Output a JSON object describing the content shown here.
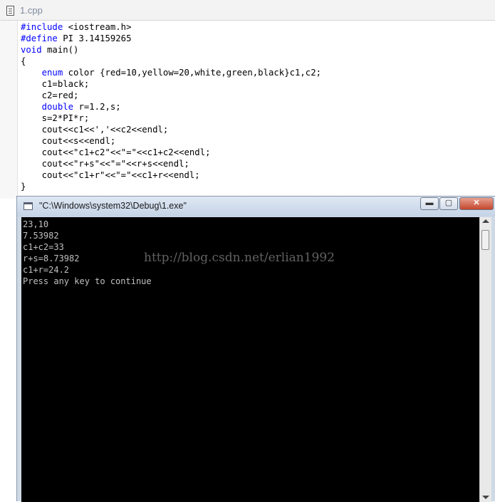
{
  "editor": {
    "tab_title": "1.cpp",
    "code_lines": [
      [
        {
          "t": "#include",
          "c": "pp"
        },
        {
          "t": " <iostream.h>"
        }
      ],
      [
        {
          "t": "#define",
          "c": "pp"
        },
        {
          "t": " PI 3.14159265"
        }
      ],
      [
        {
          "t": "void",
          "c": "kw"
        },
        {
          "t": " main()"
        }
      ],
      [
        {
          "t": "{"
        }
      ],
      [
        {
          "t": "    "
        },
        {
          "t": "enum",
          "c": "kw"
        },
        {
          "t": " color {red=10,yellow=20,white,green,black}c1,c2;"
        }
      ],
      [
        {
          "t": "    c1=black;"
        }
      ],
      [
        {
          "t": "    c2=red;"
        }
      ],
      [
        {
          "t": "    "
        },
        {
          "t": "double",
          "c": "kw"
        },
        {
          "t": " r=1.2,s;"
        }
      ],
      [
        {
          "t": "    s=2*PI*r;"
        }
      ],
      [
        {
          "t": "    cout<<c1<<','<<c2<<endl;"
        }
      ],
      [
        {
          "t": "    cout<<s<<endl;"
        }
      ],
      [
        {
          "t": "    cout<<\"c1+c2\"<<\"=\"<<c1+c2<<endl;"
        }
      ],
      [
        {
          "t": "    cout<<\"r+s\"<<\"=\"<<r+s<<endl;"
        }
      ],
      [
        {
          "t": "    cout<<\"c1+r\"<<\"=\"<<c1+r<<endl;"
        }
      ],
      [
        {
          "t": "}"
        }
      ]
    ]
  },
  "console": {
    "title": "\"C:\\Windows\\system32\\Debug\\1.exe\"",
    "minimize_symbol": "▬",
    "maximize_symbol": "▢",
    "close_symbol": "✕",
    "output_lines": [
      "23,10",
      "7.53982",
      "c1+c2=33",
      "r+s=8.73982",
      "c1+r=24.2",
      "Press any key to continue"
    ]
  },
  "watermark": "http://blog.csdn.net/erlian1992",
  "colors": {
    "keyword": "#0000ff",
    "terminal_bg": "#000000",
    "terminal_fg": "#c0c0c0"
  }
}
